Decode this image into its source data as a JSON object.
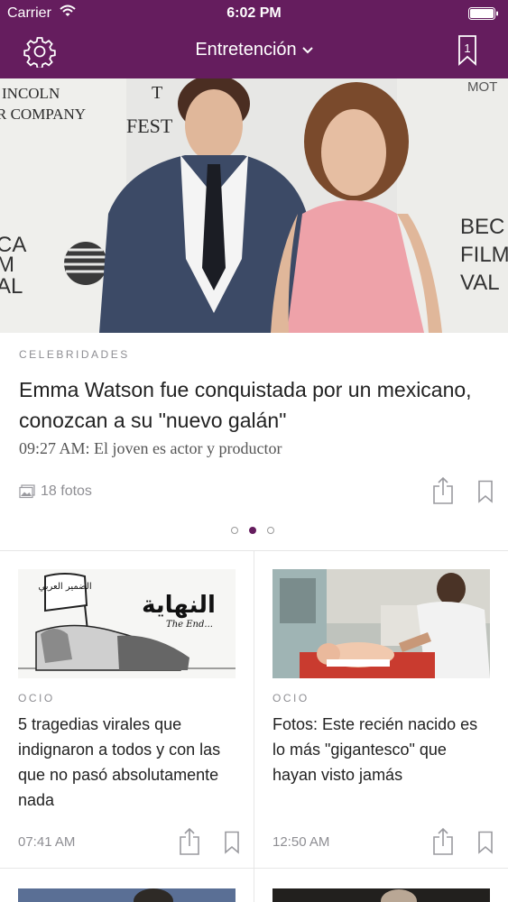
{
  "status": {
    "carrier": "Carrier",
    "time": "6:02 PM"
  },
  "nav": {
    "title": "Entretención",
    "bookmark_count": "1"
  },
  "feature": {
    "category": "CELEBRIDADES",
    "headline": "Emma Watson fue conquistada por un mexicano, conozcan a su \"nuevo galán\"",
    "subline": "09:27 AM: El joven es actor y productor",
    "photos": "18 fotos"
  },
  "pager": {
    "total": 3,
    "active": 1
  },
  "cards": [
    {
      "category": "OCIO",
      "title": "5 tragedias virales que indignaron a todos y con las que no pasó absolutamente nada",
      "time": "07:41 AM",
      "image_caption": "النهاية",
      "image_caption2": "The End...",
      "image_badge": "الضمير العربي"
    },
    {
      "category": "OCIO",
      "title": "Fotos: Este recién nacido es lo más \"gigantesco\" que hayan visto jamás",
      "time": "12:50 AM"
    }
  ],
  "hero_text": {
    "left_top": "INCOLN",
    "left_mid": "R COMPANY",
    "left_a": "CA",
    "left_b": "M",
    "left_c": "AL",
    "center_a": "T",
    "center_b": "FEST",
    "right_top": "MOT",
    "right_a": "BEC",
    "right_b": "FILM",
    "right_c": "VAL"
  },
  "colors": {
    "brand": "#651d5e",
    "meta": "#8e8e93"
  }
}
